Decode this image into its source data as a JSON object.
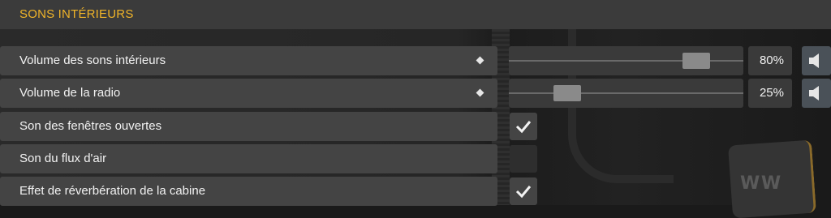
{
  "header": {
    "title": "SONS INTÉRIEURS"
  },
  "settings": [
    {
      "label": "Volume des sons intérieurs",
      "type": "slider",
      "value": 80,
      "value_text": "80%",
      "icon": "speaker-icon"
    },
    {
      "label": "Volume de la radio",
      "type": "slider",
      "value": 25,
      "value_text": "25%",
      "icon": "speaker-icon"
    },
    {
      "label": "Son des fenêtres ouvertes",
      "type": "checkbox",
      "checked": true
    },
    {
      "label": "Son du flux d'air",
      "type": "checkbox",
      "checked": false
    },
    {
      "label": "Effet de réverbération de la cabine",
      "type": "checkbox",
      "checked": true
    }
  ],
  "colors": {
    "accent": "#f0b429",
    "row_bg": "#444444",
    "header_bg": "#3b3b3b",
    "mute_bg": "#4a5158"
  }
}
